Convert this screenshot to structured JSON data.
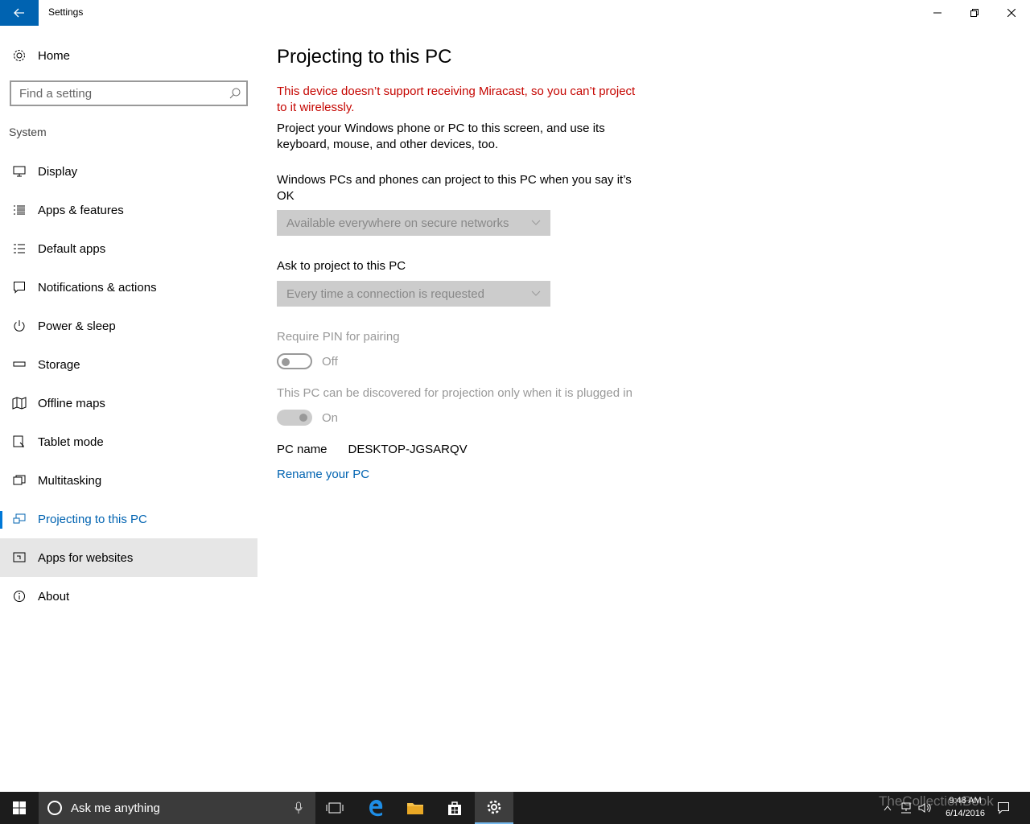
{
  "window": {
    "title": "Settings"
  },
  "sidebar": {
    "home_label": "Home",
    "search_placeholder": "Find a setting",
    "section_label": "System",
    "items": [
      {
        "label": "Display",
        "icon": "monitor-icon"
      },
      {
        "label": "Apps & features",
        "icon": "list-icon"
      },
      {
        "label": "Default apps",
        "icon": "default-apps-icon"
      },
      {
        "label": "Notifications & actions",
        "icon": "notification-icon"
      },
      {
        "label": "Power & sleep",
        "icon": "power-icon"
      },
      {
        "label": "Storage",
        "icon": "storage-icon"
      },
      {
        "label": "Offline maps",
        "icon": "map-icon"
      },
      {
        "label": "Tablet mode",
        "icon": "tablet-icon"
      },
      {
        "label": "Multitasking",
        "icon": "multitasking-icon"
      },
      {
        "label": "Projecting to this PC",
        "icon": "projecting-icon"
      },
      {
        "label": "Apps for websites",
        "icon": "apps-websites-icon"
      },
      {
        "label": "About",
        "icon": "info-icon"
      }
    ]
  },
  "main": {
    "title": "Projecting to this PC",
    "error": "This device doesn’t support receiving Miracast, so you can’t project to it wirelessly.",
    "description": "Project your Windows phone or PC to this screen, and use its keyboard, mouse, and other devices, too.",
    "project_when_label": "Windows PCs and phones can project to this PC when you say it’s OK",
    "project_when_value": "Available everywhere on secure networks",
    "ask_label": "Ask to project to this PC",
    "ask_value": "Every time a connection is requested",
    "pin_label": "Require PIN for pairing",
    "pin_state": "Off",
    "plugged_label": "This PC can be discovered for projection only when it is plugged in",
    "plugged_state": "On",
    "pc_name_label": "PC name",
    "pc_name_value": "DESKTOP-JGSARQV",
    "rename_link": "Rename your PC"
  },
  "taskbar": {
    "search_placeholder": "Ask me anything",
    "time": "9:48 AM",
    "date": "6/14/2016",
    "watermark": "TheCollectionBook"
  },
  "colors": {
    "accent": "#0063b1",
    "error": "#c50500",
    "taskbar": "#1c1c1c"
  }
}
